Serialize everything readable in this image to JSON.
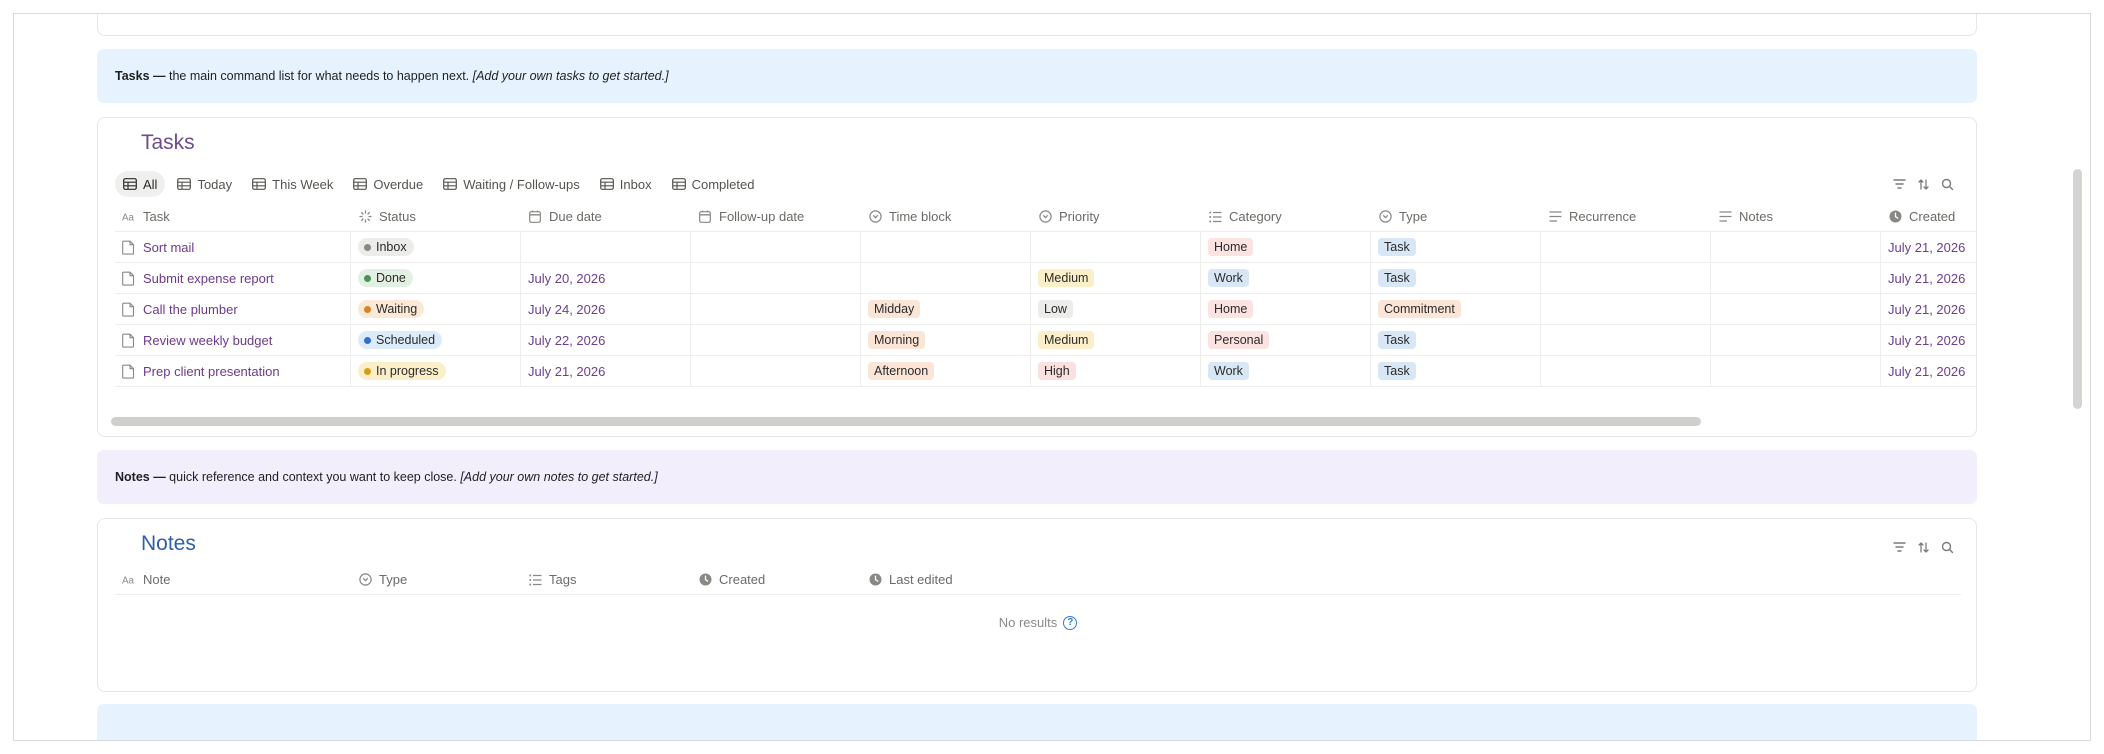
{
  "colors": {
    "tasks_title": "#6d4c8e",
    "notes_title": "#2d5fa8",
    "callout_blue": "#e6f3fe",
    "callout_purple": "#f3eefb"
  },
  "tasks_callout": {
    "bold": "Tasks —",
    "text": " the main command list for what needs to happen next. ",
    "italic": "[Add your own tasks to get started.]"
  },
  "tasks_db": {
    "title": "Tasks",
    "tabs": [
      {
        "label": "All",
        "icon": "table-icon",
        "active": true
      },
      {
        "label": "Today",
        "icon": "table-icon"
      },
      {
        "label": "This Week",
        "icon": "table-icon"
      },
      {
        "label": "Overdue",
        "icon": "table-icon"
      },
      {
        "label": "Waiting / Follow-ups",
        "icon": "table-icon"
      },
      {
        "label": "Inbox",
        "icon": "table-icon"
      },
      {
        "label": "Completed",
        "icon": "table-icon"
      }
    ],
    "tool_icons": [
      "filter-icon",
      "sort-icon",
      "search-icon"
    ],
    "columns": [
      {
        "label": "Task",
        "icon": "text-aa-icon"
      },
      {
        "label": "Status",
        "icon": "status-spinner-icon"
      },
      {
        "label": "Due date",
        "icon": "calendar-icon"
      },
      {
        "label": "Follow-up date",
        "icon": "calendar-icon"
      },
      {
        "label": "Time block",
        "icon": "select-circle-icon"
      },
      {
        "label": "Priority",
        "icon": "select-circle-icon"
      },
      {
        "label": "Category",
        "icon": "list-icon"
      },
      {
        "label": "Type",
        "icon": "select-circle-icon"
      },
      {
        "label": "Recurrence",
        "icon": "lines-icon"
      },
      {
        "label": "Notes",
        "icon": "lines-icon"
      },
      {
        "label": "Created",
        "icon": "clock-icon"
      }
    ],
    "rows": [
      {
        "task": "Sort mail",
        "status": "Inbox",
        "due": "",
        "followup": "",
        "timeblock": "",
        "priority": "",
        "category": "Home",
        "type": "Task",
        "recurrence": "",
        "notes": "",
        "created": "July 21, 2026"
      },
      {
        "task": "Submit expense report",
        "status": "Done",
        "due": "July 20, 2026",
        "followup": "",
        "timeblock": "",
        "priority": "Medium",
        "category": "Work",
        "type": "Task",
        "recurrence": "",
        "notes": "",
        "created": "July 21, 2026"
      },
      {
        "task": "Call the plumber",
        "status": "Waiting",
        "due": "July 24, 2026",
        "followup": "",
        "timeblock": "Midday",
        "priority": "Low",
        "category": "Home",
        "type": "Commitment",
        "recurrence": "",
        "notes": "",
        "created": "July 21, 2026"
      },
      {
        "task": "Review weekly budget",
        "status": "Scheduled",
        "due": "July 22, 2026",
        "followup": "",
        "timeblock": "Morning",
        "priority": "Medium",
        "category": "Personal",
        "type": "Task",
        "recurrence": "",
        "notes": "",
        "created": "July 21, 2026"
      },
      {
        "task": "Prep client presentation",
        "status": "In progress",
        "due": "July 21, 2026",
        "followup": "",
        "timeblock": "Afternoon",
        "priority": "High",
        "category": "Work",
        "type": "Task",
        "recurrence": "",
        "notes": "",
        "created": "July 21, 2026"
      }
    ]
  },
  "notes_callout": {
    "bold": "Notes —",
    "text": " quick reference and context you want to keep close. ",
    "italic": "[Add your own notes to get started.]"
  },
  "notes_db": {
    "title": "Notes",
    "tool_icons": [
      "filter-icon",
      "sort-icon",
      "search-icon"
    ],
    "columns": [
      {
        "label": "Note",
        "icon": "text-aa-icon"
      },
      {
        "label": "Type",
        "icon": "select-circle-icon"
      },
      {
        "label": "Tags",
        "icon": "list-icon"
      },
      {
        "label": "Created",
        "icon": "clock-icon"
      },
      {
        "label": "Last edited",
        "icon": "clock-icon"
      }
    ],
    "empty_text": "No results"
  }
}
